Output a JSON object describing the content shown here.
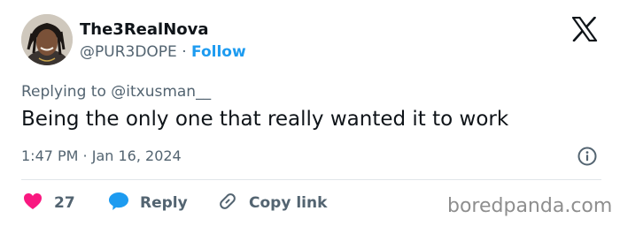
{
  "author": {
    "display_name": "The3RealNova",
    "handle": "@PUR3DOPE",
    "separator": "·",
    "follow_label": "Follow"
  },
  "reply": {
    "prefix": "Replying to",
    "mention": "@itxusman__"
  },
  "tweet": {
    "text": "Being the only one that really wanted it to work",
    "timestamp": "1:47 PM · Jan 16, 2024"
  },
  "actions": {
    "like_count": "27",
    "reply_label": "Reply",
    "copy_link_label": "Copy link"
  },
  "watermark": "boredpanda.com",
  "colors": {
    "accent": "#1d9bf0",
    "like": "#f91880",
    "text": "#0f1419",
    "muted": "#536471"
  },
  "icons": [
    "x-logo-icon",
    "info-icon",
    "heart-icon",
    "reply-bubble-icon",
    "link-icon"
  ]
}
